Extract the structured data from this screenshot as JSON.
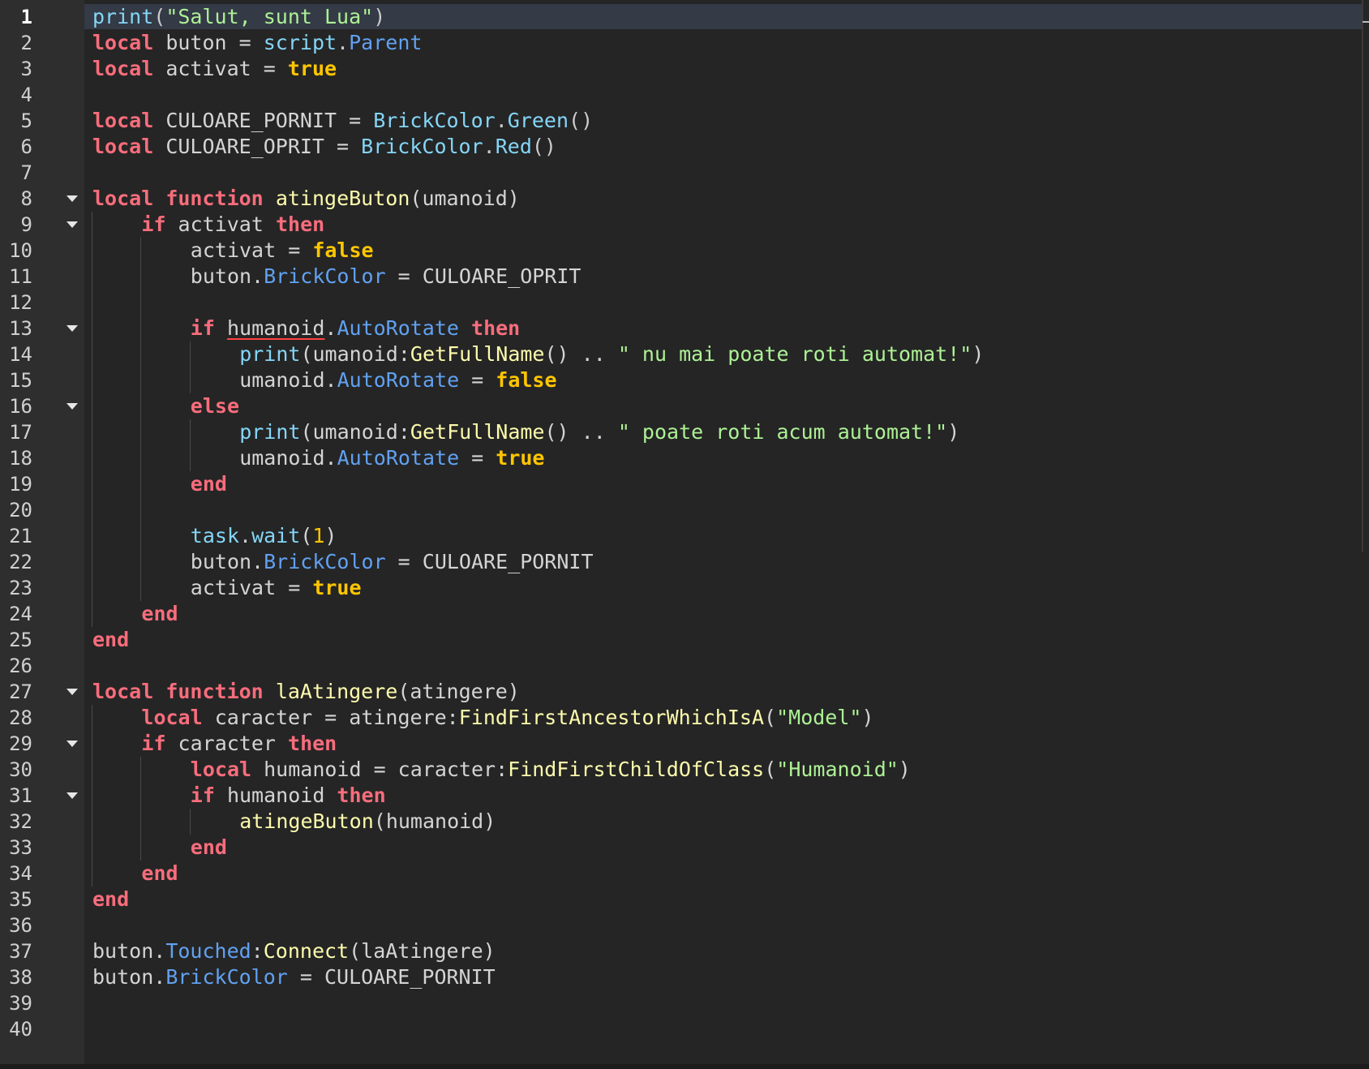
{
  "editor": {
    "language": "Lua",
    "current_line": 1,
    "line_numbers": [
      "1",
      "2",
      "3",
      "4",
      "5",
      "6",
      "7",
      "8",
      "9",
      "10",
      "11",
      "12",
      "13",
      "14",
      "15",
      "16",
      "17",
      "18",
      "19",
      "20",
      "21",
      "22",
      "23",
      "24",
      "25",
      "26",
      "27",
      "28",
      "29",
      "30",
      "31",
      "32",
      "33",
      "34",
      "35",
      "36",
      "37",
      "38",
      "39",
      "40"
    ],
    "fold_lines": [
      8,
      9,
      13,
      16,
      27,
      29,
      31
    ],
    "lines": [
      {
        "indent": 0,
        "tokens": [
          {
            "t": "print",
            "c": "builtin"
          },
          {
            "t": "(",
            "c": "punct"
          },
          {
            "t": "\"Salut, sunt Lua\"",
            "c": "str"
          },
          {
            "t": ")",
            "c": "punct"
          }
        ]
      },
      {
        "indent": 0,
        "tokens": [
          {
            "t": "local",
            "c": "kw"
          },
          {
            "t": " buton = ",
            "c": "plain"
          },
          {
            "t": "script",
            "c": "builtin"
          },
          {
            "t": ".",
            "c": "punct"
          },
          {
            "t": "Parent",
            "c": "prop"
          }
        ]
      },
      {
        "indent": 0,
        "tokens": [
          {
            "t": "local",
            "c": "kw"
          },
          {
            "t": " activat = ",
            "c": "plain"
          },
          {
            "t": "true",
            "c": "bool"
          }
        ]
      },
      {
        "indent": 0,
        "tokens": []
      },
      {
        "indent": 0,
        "tokens": [
          {
            "t": "local",
            "c": "kw"
          },
          {
            "t": " CULOARE_PORNIT = ",
            "c": "plain"
          },
          {
            "t": "BrickColor",
            "c": "builtin"
          },
          {
            "t": ".",
            "c": "punct"
          },
          {
            "t": "Green",
            "c": "builtin"
          },
          {
            "t": "()",
            "c": "punct"
          }
        ]
      },
      {
        "indent": 0,
        "tokens": [
          {
            "t": "local",
            "c": "kw"
          },
          {
            "t": " CULOARE_OPRIT = ",
            "c": "plain"
          },
          {
            "t": "BrickColor",
            "c": "builtin"
          },
          {
            "t": ".",
            "c": "punct"
          },
          {
            "t": "Red",
            "c": "builtin"
          },
          {
            "t": "()",
            "c": "punct"
          }
        ]
      },
      {
        "indent": 0,
        "tokens": []
      },
      {
        "indent": 0,
        "tokens": [
          {
            "t": "local",
            "c": "kw"
          },
          {
            "t": " ",
            "c": "plain"
          },
          {
            "t": "function",
            "c": "kw"
          },
          {
            "t": " ",
            "c": "plain"
          },
          {
            "t": "atingeButon",
            "c": "method"
          },
          {
            "t": "(umanoid)",
            "c": "plain"
          }
        ]
      },
      {
        "indent": 1,
        "tokens": [
          {
            "t": "if",
            "c": "kw"
          },
          {
            "t": " activat ",
            "c": "plain"
          },
          {
            "t": "then",
            "c": "kw"
          }
        ]
      },
      {
        "indent": 2,
        "tokens": [
          {
            "t": "activat = ",
            "c": "plain"
          },
          {
            "t": "false",
            "c": "bool"
          }
        ]
      },
      {
        "indent": 2,
        "tokens": [
          {
            "t": "buton.",
            "c": "plain"
          },
          {
            "t": "BrickColor",
            "c": "prop"
          },
          {
            "t": " = CULOARE_OPRIT",
            "c": "plain"
          }
        ]
      },
      {
        "indent": 0,
        "tokens": []
      },
      {
        "indent": 2,
        "tokens": [
          {
            "t": "if",
            "c": "kw"
          },
          {
            "t": " ",
            "c": "plain"
          },
          {
            "t": "humanoid",
            "c": "err"
          },
          {
            "t": ".",
            "c": "plain"
          },
          {
            "t": "AutoRotate",
            "c": "prop"
          },
          {
            "t": " ",
            "c": "plain"
          },
          {
            "t": "then",
            "c": "kw"
          }
        ]
      },
      {
        "indent": 3,
        "tokens": [
          {
            "t": "print",
            "c": "builtin"
          },
          {
            "t": "(umanoid:",
            "c": "plain"
          },
          {
            "t": "GetFullName",
            "c": "method"
          },
          {
            "t": "() .. ",
            "c": "plain"
          },
          {
            "t": "\" nu mai poate roti automat!\"",
            "c": "str"
          },
          {
            "t": ")",
            "c": "plain"
          }
        ]
      },
      {
        "indent": 3,
        "tokens": [
          {
            "t": "umanoid.",
            "c": "plain"
          },
          {
            "t": "AutoRotate",
            "c": "prop"
          },
          {
            "t": " = ",
            "c": "plain"
          },
          {
            "t": "false",
            "c": "bool"
          }
        ]
      },
      {
        "indent": 2,
        "tokens": [
          {
            "t": "else",
            "c": "kw"
          }
        ]
      },
      {
        "indent": 3,
        "tokens": [
          {
            "t": "print",
            "c": "builtin"
          },
          {
            "t": "(umanoid:",
            "c": "plain"
          },
          {
            "t": "GetFullName",
            "c": "method"
          },
          {
            "t": "() .. ",
            "c": "plain"
          },
          {
            "t": "\" poate roti acum automat!\"",
            "c": "str"
          },
          {
            "t": ")",
            "c": "plain"
          }
        ]
      },
      {
        "indent": 3,
        "tokens": [
          {
            "t": "umanoid.",
            "c": "plain"
          },
          {
            "t": "AutoRotate",
            "c": "prop"
          },
          {
            "t": " = ",
            "c": "plain"
          },
          {
            "t": "true",
            "c": "bool"
          }
        ]
      },
      {
        "indent": 2,
        "tokens": [
          {
            "t": "end",
            "c": "kw"
          }
        ]
      },
      {
        "indent": 0,
        "tokens": []
      },
      {
        "indent": 2,
        "tokens": [
          {
            "t": "task",
            "c": "builtin"
          },
          {
            "t": ".",
            "c": "punct"
          },
          {
            "t": "wait",
            "c": "builtin"
          },
          {
            "t": "(",
            "c": "plain"
          },
          {
            "t": "1",
            "c": "num"
          },
          {
            "t": ")",
            "c": "plain"
          }
        ]
      },
      {
        "indent": 2,
        "tokens": [
          {
            "t": "buton.",
            "c": "plain"
          },
          {
            "t": "BrickColor",
            "c": "prop"
          },
          {
            "t": " = CULOARE_PORNIT",
            "c": "plain"
          }
        ]
      },
      {
        "indent": 2,
        "tokens": [
          {
            "t": "activat = ",
            "c": "plain"
          },
          {
            "t": "true",
            "c": "bool"
          }
        ]
      },
      {
        "indent": 1,
        "tokens": [
          {
            "t": "end",
            "c": "kw"
          }
        ]
      },
      {
        "indent": 0,
        "tokens": [
          {
            "t": "end",
            "c": "kw"
          }
        ]
      },
      {
        "indent": 0,
        "tokens": []
      },
      {
        "indent": 0,
        "tokens": [
          {
            "t": "local",
            "c": "kw"
          },
          {
            "t": " ",
            "c": "plain"
          },
          {
            "t": "function",
            "c": "kw"
          },
          {
            "t": " ",
            "c": "plain"
          },
          {
            "t": "laAtingere",
            "c": "method"
          },
          {
            "t": "(atingere)",
            "c": "plain"
          }
        ]
      },
      {
        "indent": 1,
        "tokens": [
          {
            "t": "local",
            "c": "kw"
          },
          {
            "t": " caracter = atingere:",
            "c": "plain"
          },
          {
            "t": "FindFirstAncestorWhichIsA",
            "c": "method"
          },
          {
            "t": "(",
            "c": "plain"
          },
          {
            "t": "\"Model\"",
            "c": "str"
          },
          {
            "t": ")",
            "c": "plain"
          }
        ]
      },
      {
        "indent": 1,
        "tokens": [
          {
            "t": "if",
            "c": "kw"
          },
          {
            "t": " caracter ",
            "c": "plain"
          },
          {
            "t": "then",
            "c": "kw"
          }
        ]
      },
      {
        "indent": 2,
        "tokens": [
          {
            "t": "local",
            "c": "kw"
          },
          {
            "t": " humanoid = caracter:",
            "c": "plain"
          },
          {
            "t": "FindFirstChildOfClass",
            "c": "method"
          },
          {
            "t": "(",
            "c": "plain"
          },
          {
            "t": "\"Humanoid\"",
            "c": "str"
          },
          {
            "t": ")",
            "c": "plain"
          }
        ]
      },
      {
        "indent": 2,
        "tokens": [
          {
            "t": "if",
            "c": "kw"
          },
          {
            "t": " humanoid ",
            "c": "plain"
          },
          {
            "t": "then",
            "c": "kw"
          }
        ]
      },
      {
        "indent": 3,
        "tokens": [
          {
            "t": "atingeButon",
            "c": "method"
          },
          {
            "t": "(humanoid)",
            "c": "plain"
          }
        ]
      },
      {
        "indent": 2,
        "tokens": [
          {
            "t": "end",
            "c": "kw"
          }
        ]
      },
      {
        "indent": 1,
        "tokens": [
          {
            "t": "end",
            "c": "kw"
          }
        ]
      },
      {
        "indent": 0,
        "tokens": [
          {
            "t": "end",
            "c": "kw"
          }
        ]
      },
      {
        "indent": 0,
        "tokens": []
      },
      {
        "indent": 0,
        "tokens": [
          {
            "t": "buton.",
            "c": "plain"
          },
          {
            "t": "Touched",
            "c": "prop"
          },
          {
            "t": ":",
            "c": "plain"
          },
          {
            "t": "Connect",
            "c": "method"
          },
          {
            "t": "(laAtingere)",
            "c": "plain"
          }
        ]
      },
      {
        "indent": 0,
        "tokens": [
          {
            "t": "buton.",
            "c": "plain"
          },
          {
            "t": "BrickColor",
            "c": "prop"
          },
          {
            "t": " = CULOARE_PORNIT",
            "c": "plain"
          }
        ]
      },
      {
        "indent": 0,
        "tokens": []
      },
      {
        "indent": 0,
        "tokens": []
      }
    ],
    "fold_icon": "chevron-down-icon",
    "colors": {
      "background": "#252525",
      "gutter": "#2e2e2e",
      "keyword": "#f86d7c",
      "boolean": "#ffc600",
      "string": "#adf195",
      "builtin": "#84d6f7",
      "property": "#61a1f1",
      "method": "#fdfbac",
      "plain": "#d4d4d4",
      "current_line": "#343a46"
    }
  }
}
